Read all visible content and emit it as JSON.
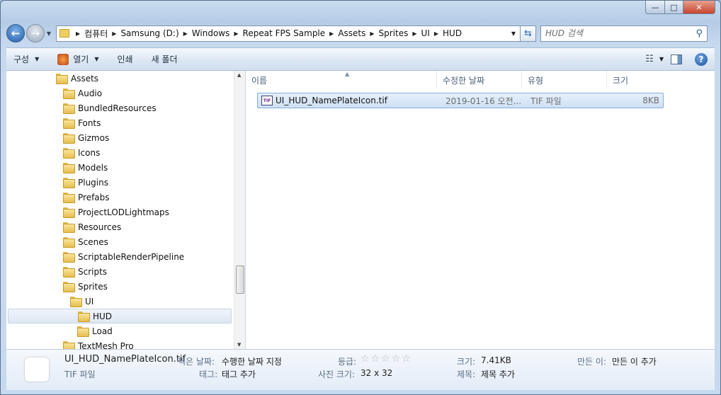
{
  "address": {
    "crumbs": [
      "컴퓨터",
      "Samsung (D:)",
      "Windows",
      "Repeat FPS Sample",
      "Assets",
      "Sprites",
      "UI",
      "HUD"
    ]
  },
  "search": {
    "placeholder": "HUD 검색"
  },
  "toolbar": {
    "organize": "구성",
    "open": "열기",
    "print": "인쇄",
    "new_folder": "새 폴더"
  },
  "tree": {
    "items": [
      {
        "label": "Assets",
        "level": 0
      },
      {
        "label": "Audio",
        "level": 1
      },
      {
        "label": "BundledResources",
        "level": 1
      },
      {
        "label": "Fonts",
        "level": 1
      },
      {
        "label": "Gizmos",
        "level": 1
      },
      {
        "label": "Icons",
        "level": 1
      },
      {
        "label": "Models",
        "level": 1
      },
      {
        "label": "Plugins",
        "level": 1
      },
      {
        "label": "Prefabs",
        "level": 1
      },
      {
        "label": "ProjectLODLightmaps",
        "level": 1
      },
      {
        "label": "Resources",
        "level": 1
      },
      {
        "label": "Scenes",
        "level": 1
      },
      {
        "label": "ScriptableRenderPipeline",
        "level": 1
      },
      {
        "label": "Scripts",
        "level": 1
      },
      {
        "label": "Sprites",
        "level": 1
      },
      {
        "label": "UI",
        "level": 2
      },
      {
        "label": "HUD",
        "level": 3,
        "selected": true
      },
      {
        "label": "Load",
        "level": 3
      },
      {
        "label": "TextMesh Pro",
        "level": 1
      }
    ]
  },
  "columns": {
    "name": "이름",
    "modified": "수정한 날짜",
    "type": "유형",
    "size": "크기"
  },
  "files": [
    {
      "name": "UI_HUD_NamePlateIcon.tif",
      "icon_text": "TIF",
      "modified": "2019-01-16 오전...",
      "type": "TIF 파일",
      "size": "8KB"
    }
  ],
  "details": {
    "filename": "UI_HUD_NamePlateIcon.tif",
    "filetype": "TIF 파일",
    "date_taken_label": "찍은 날짜:",
    "date_taken_value": "수행한 날짜 지정",
    "tags_label": "태그:",
    "tags_value": "태그 추가",
    "rating_label": "등급:",
    "rating_stars": "☆☆☆☆☆",
    "dimensions_label": "사진 크기:",
    "dimensions_value": "32 x 32",
    "size_label": "크기:",
    "size_value": "7.41KB",
    "title_label": "제목:",
    "title_value": "제목 추가",
    "author_label": "만든 이:",
    "author_value": "만든 이 추가"
  },
  "colors": {
    "selection_bg": "#cfe0f5",
    "selection_border": "#84acdd",
    "folder": "#e6bd4f"
  }
}
